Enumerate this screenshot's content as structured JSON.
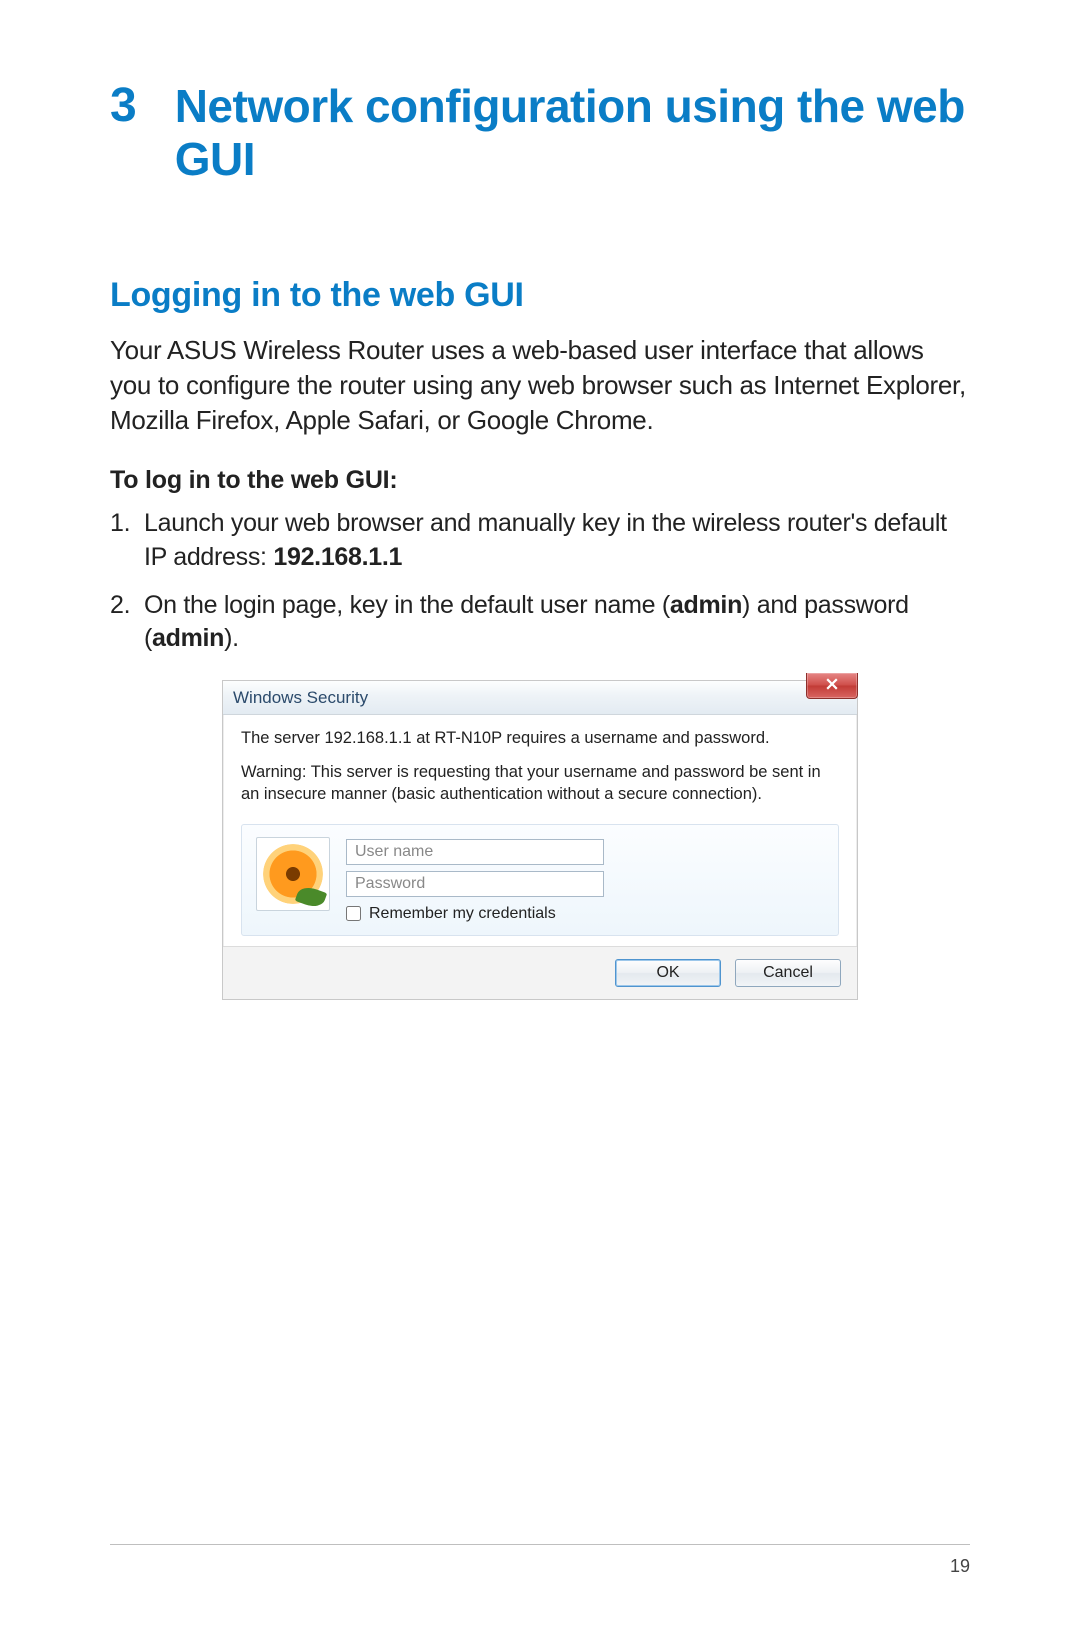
{
  "chapter": {
    "number": "3",
    "title": "Network configuration using the web GUI"
  },
  "section_title": "Logging in to the web GUI",
  "intro": "Your ASUS Wireless Router uses a web-based user interface that allows you to configure the router using any web browser such as Internet Explorer, Mozilla Firefox, Apple Safari, or Google Chrome.",
  "subhead": "To log in to the web GUI:",
  "steps": {
    "s1_pre": "Launch your web browser and manually key in the wireless router's default IP address: ",
    "s1_bold": "192.168.1.1",
    "s2_a": "On the login page, key in the default user name (",
    "s2_b1": "admin",
    "s2_c": ") and password (",
    "s2_b2": "admin",
    "s2_d": ")."
  },
  "dialog": {
    "title": "Windows Security",
    "line1": "The server 192.168.1.1 at RT-N10P  requires a username and password.",
    "warning": "Warning: This server is requesting that your username and password be sent in an insecure manner (basic authentication without a secure connection).",
    "username_placeholder": "User name",
    "password_placeholder": "Password",
    "remember_label": "Remember my credentials",
    "ok_label": "OK",
    "cancel_label": "Cancel"
  },
  "page_number": "19"
}
